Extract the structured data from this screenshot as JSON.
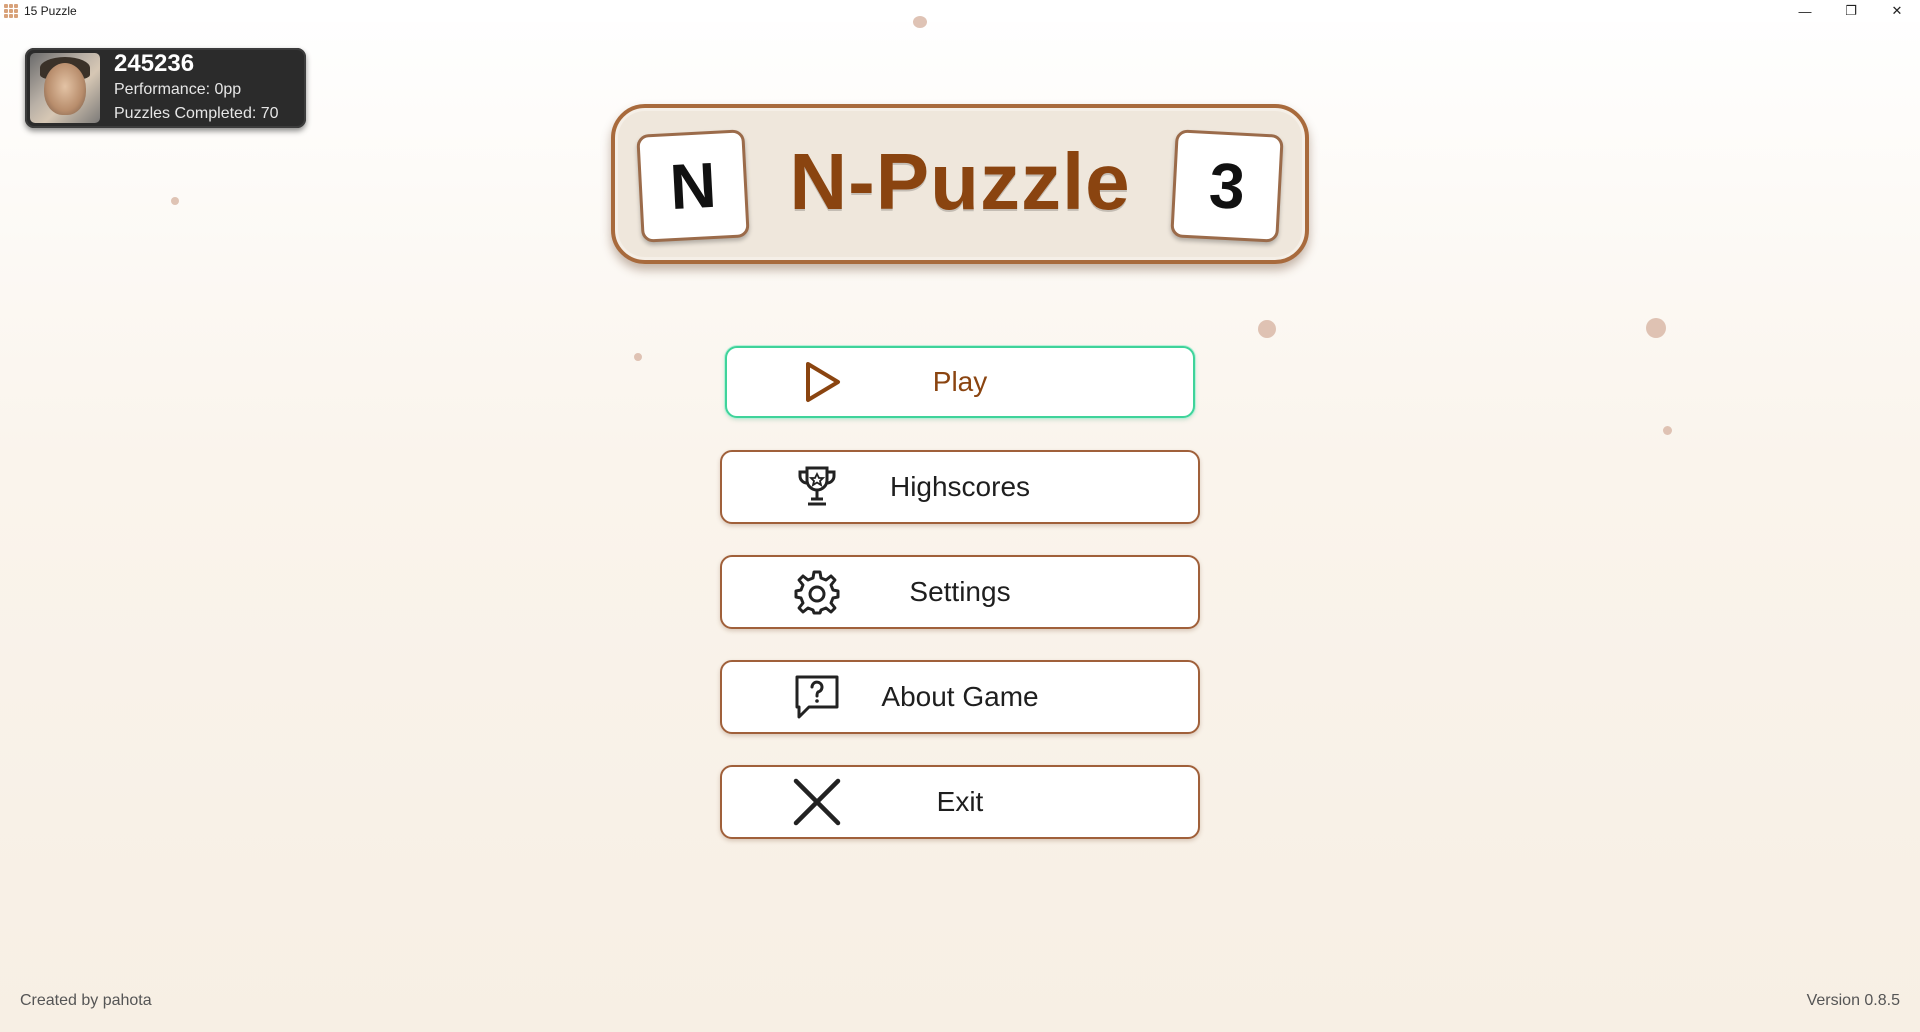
{
  "window": {
    "title": "15 Puzzle",
    "controls": {
      "minimize": "—",
      "maximize": "❐",
      "close": "✕"
    }
  },
  "profile": {
    "name": "245236",
    "performance": "Performance: 0pp",
    "puzzles_completed": "Puzzles Completed: 70"
  },
  "logo": {
    "left_tile": "N",
    "title": "N-Puzzle",
    "right_tile": "3"
  },
  "menu": {
    "play": {
      "label": "Play",
      "icon": "play-icon"
    },
    "highscores": {
      "label": "Highscores",
      "icon": "trophy-icon"
    },
    "settings": {
      "label": "Settings",
      "icon": "gear-icon"
    },
    "about": {
      "label": "About Game",
      "icon": "question-bubble-icon"
    },
    "exit": {
      "label": "Exit",
      "icon": "close-icon"
    }
  },
  "footer": {
    "credit": "Created by pahota",
    "version": "Version 0.8.5"
  },
  "colors": {
    "accent_brown": "#8a4410",
    "border_brown": "#a0603a",
    "play_border": "#3fd39a",
    "background": "#faf4ec"
  }
}
